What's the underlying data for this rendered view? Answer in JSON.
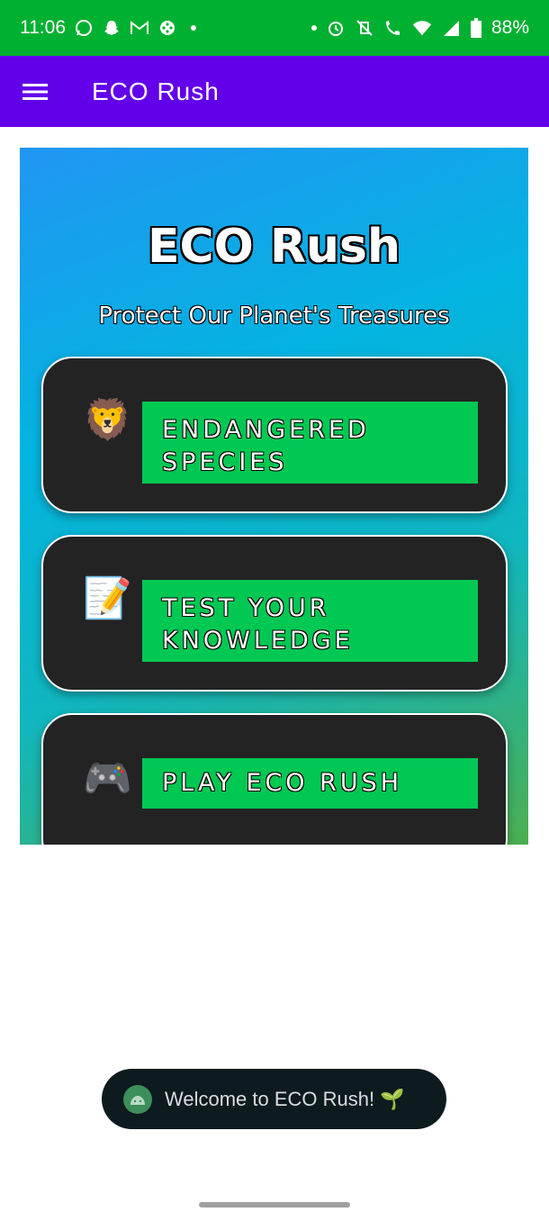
{
  "status_bar": {
    "time": "11:06",
    "battery": "88%",
    "left_icons": [
      "whatsapp-icon",
      "snapchat-icon",
      "gmail-icon",
      "game-controller-icon"
    ],
    "right_icons": [
      "alarm-icon",
      "vibrate-off-icon",
      "wifi-calling-icon",
      "wifi-icon",
      "signal-icon",
      "battery-icon"
    ]
  },
  "app_bar": {
    "title": "ECO Rush",
    "menu_icon": "hamburger-menu-icon",
    "background": "#6200ea"
  },
  "hero": {
    "title": "ECO Rush",
    "subtitle": "Protect Our Planet's Treasures"
  },
  "menu": [
    {
      "emoji": "🦁",
      "icon": "lion-icon",
      "label_line1": "ENDANGERED",
      "label_line2": "SPECIES"
    },
    {
      "emoji": "📝",
      "icon": "memo-icon",
      "label_line1": "TEST YOUR",
      "label_line2": "KNOWLEDGE"
    },
    {
      "emoji": "🎮",
      "icon": "game-controller-icon",
      "label_line1": "PLAY ECO RUSH",
      "label_line2": ""
    }
  ],
  "toast": {
    "text": "Welcome to ECO Rush! 🌱"
  },
  "colors": {
    "status_bar": "#00b030",
    "accent_green": "#00c853",
    "card": "#232323"
  }
}
